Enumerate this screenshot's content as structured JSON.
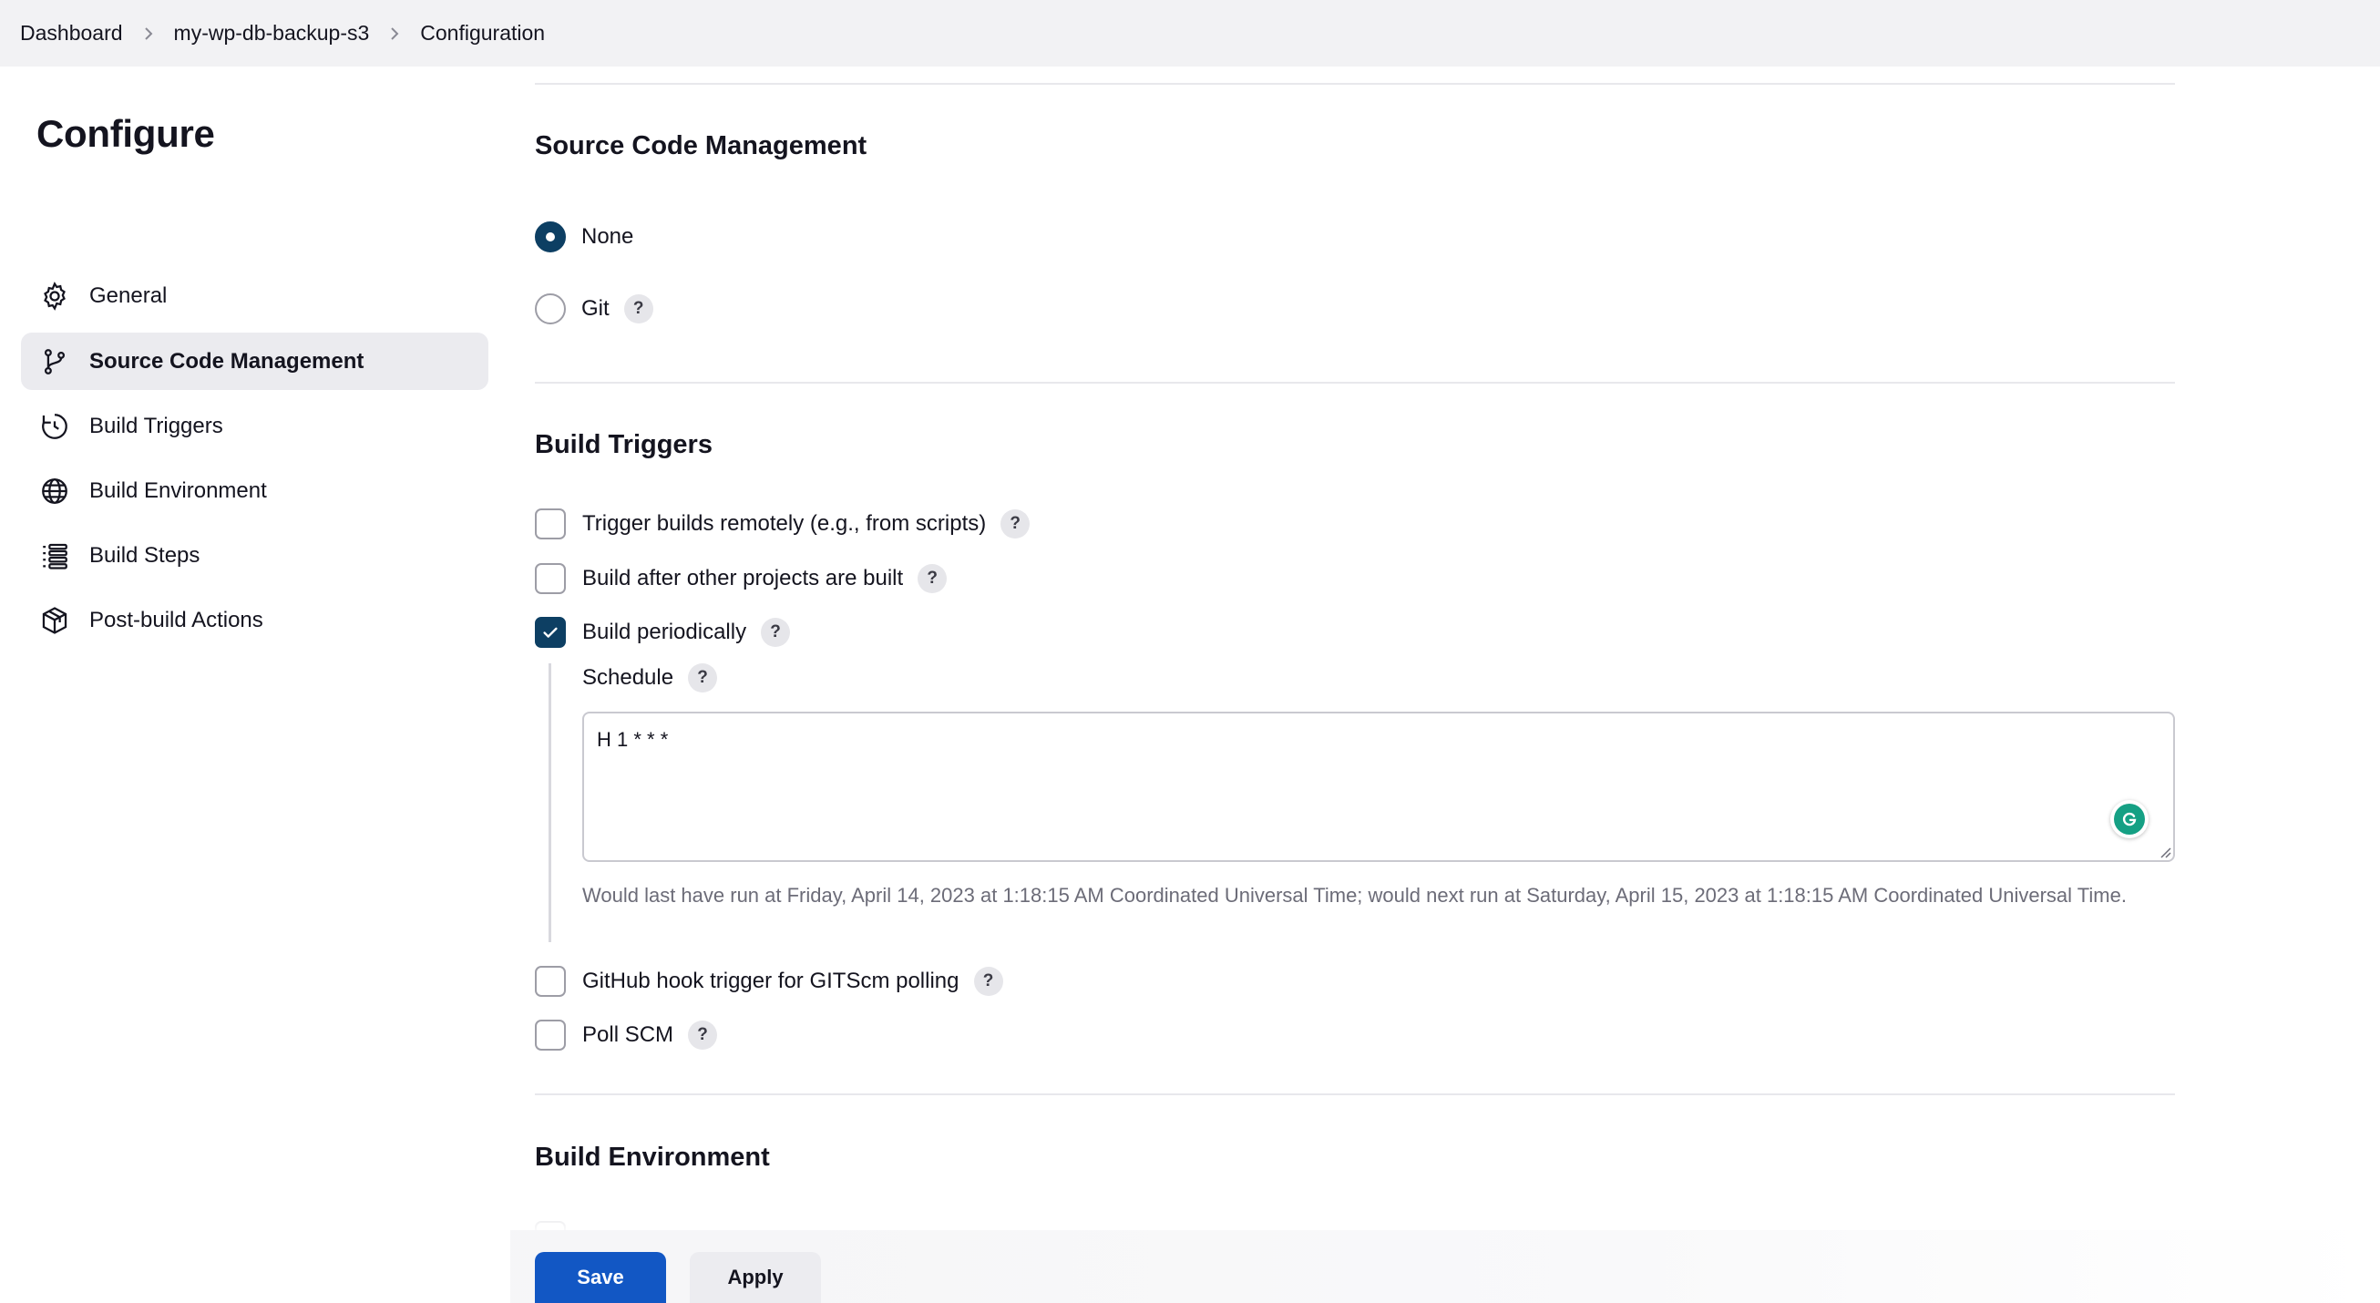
{
  "breadcrumb": {
    "items": [
      "Dashboard",
      "my-wp-db-backup-s3",
      "Configuration"
    ]
  },
  "sidebar": {
    "title": "Configure",
    "items": [
      {
        "label": "General",
        "icon": "gear-icon"
      },
      {
        "label": "Source Code Management",
        "icon": "git-branch-icon",
        "active": true
      },
      {
        "label": "Build Triggers",
        "icon": "clock-icon"
      },
      {
        "label": "Build Environment",
        "icon": "globe-icon"
      },
      {
        "label": "Build Steps",
        "icon": "list-icon"
      },
      {
        "label": "Post-build Actions",
        "icon": "package-icon"
      }
    ]
  },
  "scm": {
    "title": "Source Code Management",
    "options": [
      {
        "label": "None",
        "selected": true
      },
      {
        "label": "Git",
        "selected": false
      }
    ]
  },
  "triggers": {
    "title": "Build Triggers",
    "options": [
      {
        "label": "Trigger builds remotely (e.g., from scripts)",
        "checked": false
      },
      {
        "label": "Build after other projects are built",
        "checked": false
      },
      {
        "label": "Build periodically",
        "checked": true
      },
      {
        "label": "GitHub hook trigger for GITScm polling",
        "checked": false
      },
      {
        "label": "Poll SCM",
        "checked": false
      }
    ],
    "schedule": {
      "label": "Schedule",
      "value": "H 1 * * *",
      "hint": "Would last have run at Friday, April 14, 2023 at 1:18:15 AM Coordinated Universal Time; would next run at Saturday, April 15, 2023 at 1:18:15 AM Coordinated Universal Time."
    }
  },
  "environment": {
    "title": "Build Environment"
  },
  "footer": {
    "save_label": "Save",
    "apply_label": "Apply"
  },
  "help_glyph": "?",
  "colors": {
    "accent": "#0d3f63",
    "primary_button": "#1257c4",
    "grammarly": "#15a084"
  }
}
